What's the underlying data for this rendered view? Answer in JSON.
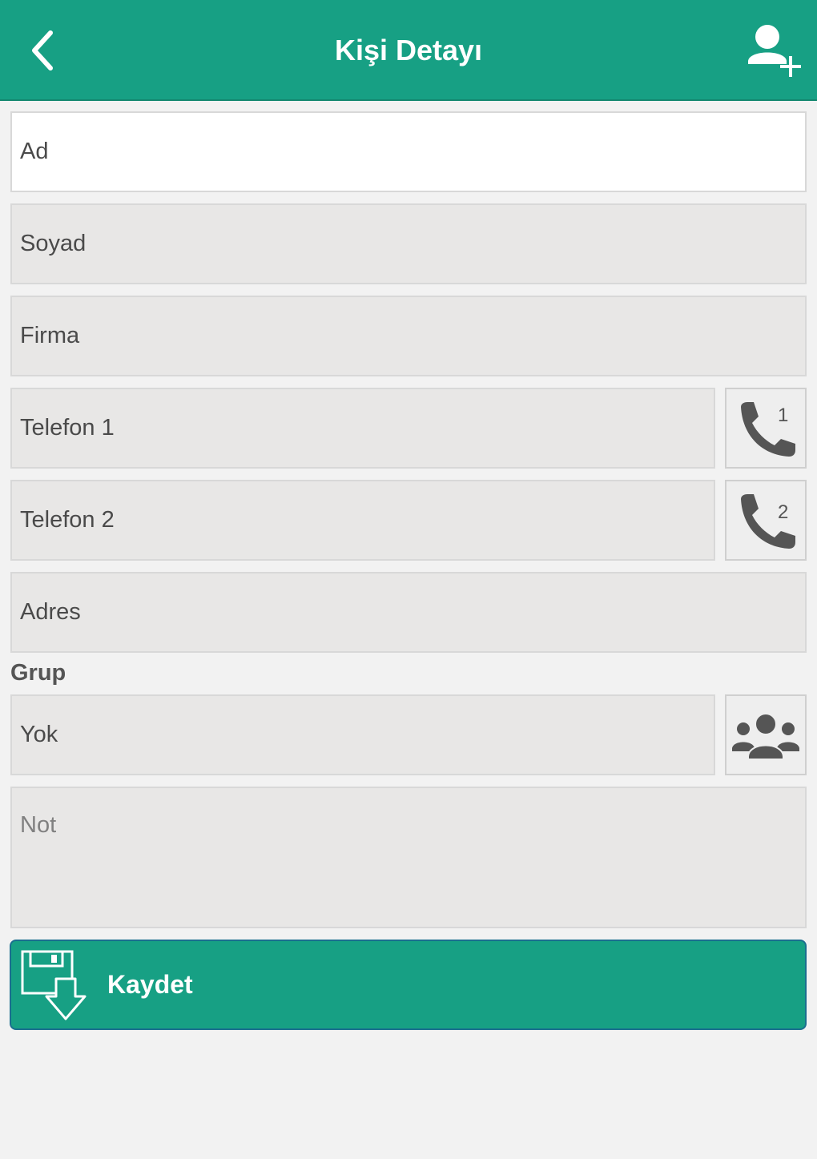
{
  "header": {
    "title": "Kişi Detayı",
    "back_icon": "chevron-left-icon",
    "add_user_icon": "add-user-icon"
  },
  "form": {
    "ad": {
      "label": "Ad"
    },
    "soyad": {
      "label": "Soyad"
    },
    "firma": {
      "label": "Firma"
    },
    "telefon1": {
      "label": "Telefon 1",
      "call_badge": "1"
    },
    "telefon2": {
      "label": "Telefon 2",
      "call_badge": "2"
    },
    "adres": {
      "label": "Adres"
    },
    "grup": {
      "section_label": "Grup",
      "value": "Yok",
      "icon": "group-icon"
    },
    "not": {
      "placeholder": "Not"
    }
  },
  "actions": {
    "save_label": "Kaydet",
    "save_icon": "floppy-download-icon"
  },
  "colors": {
    "accent": "#17a084",
    "field_bg": "#e8e7e6",
    "page_bg": "#f2f2f2",
    "icon_gray": "#555555"
  }
}
